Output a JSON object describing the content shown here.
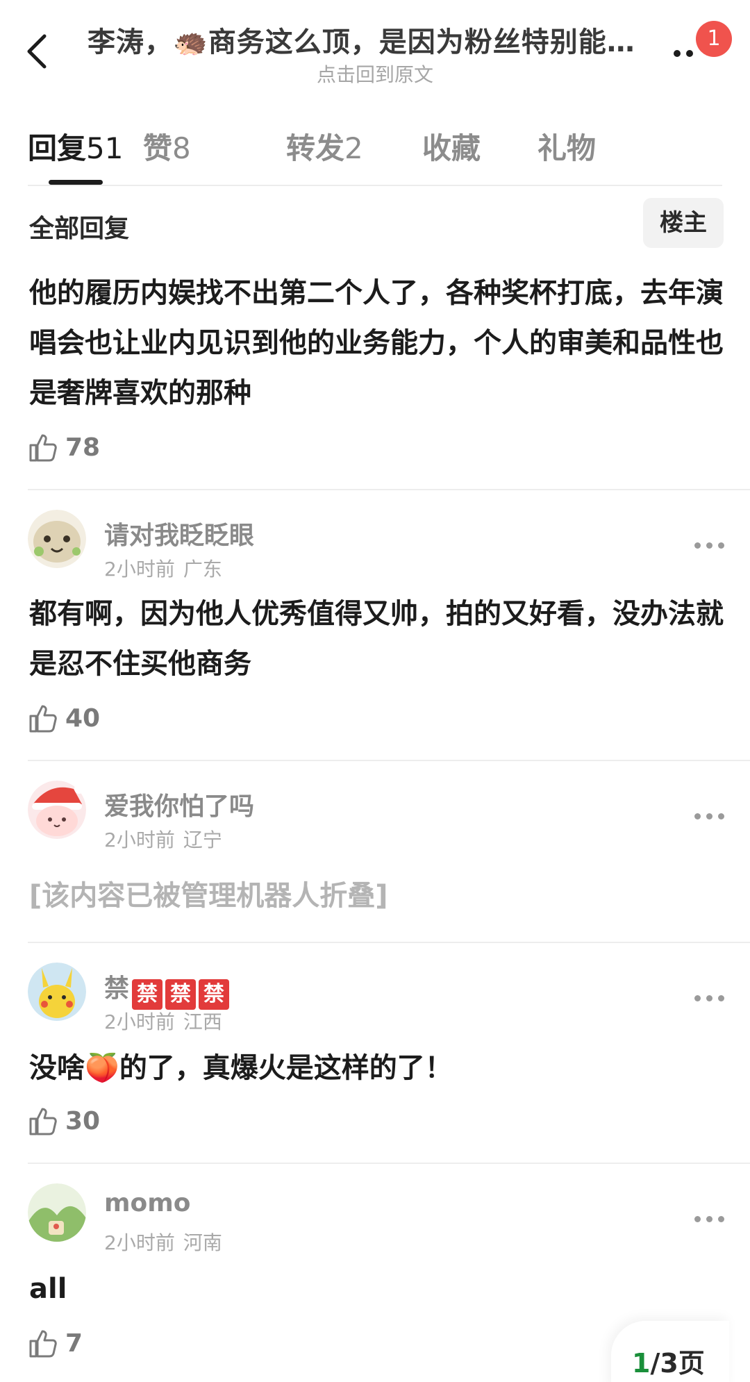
{
  "header": {
    "title_before": "李涛，",
    "title_emoji": "🦔",
    "title_after": "商务这么顶，是因为粉丝特别能…",
    "subtitle": "点击回到原文",
    "notification_count": "1"
  },
  "tabs": [
    {
      "label": "回复",
      "count": "51"
    },
    {
      "label": "赞",
      "count": "8"
    },
    {
      "label": "转发",
      "count": "2"
    },
    {
      "label": "收藏",
      "count": ""
    },
    {
      "label": "礼物",
      "count": ""
    }
  ],
  "section": {
    "title": "全部回复",
    "owner_button": "楼主"
  },
  "comments": [
    {
      "text": "他的履历内娱找不出第二个人了，各种奖杯打底，去年演唱会也让业内见识到他的业务能力，个人的审美和品性也是奢牌喜欢的那种",
      "likes": "78"
    },
    {
      "username": "请对我眨眨眼",
      "time": "2小时前",
      "location": "广东",
      "text": "都有啊，因为他人优秀值得又帅，拍的又好看，没办法就是忍不住买他商务",
      "likes": "40"
    },
    {
      "username": "爱我你怕了吗",
      "time": "2小时前",
      "location": "辽宁",
      "text": "[该内容已被管理机器人折叠]"
    },
    {
      "username": "禁",
      "username_badges": [
        "禁",
        "禁",
        "禁"
      ],
      "time": "2小时前",
      "location": "江西",
      "text_before": "没啥",
      "text_emoji": "🍑",
      "text_after": "的了，真爆火是这样的了！",
      "likes": "30"
    },
    {
      "username": "momo",
      "time": "2小时前",
      "location": "河南",
      "text": "all",
      "likes": "7"
    }
  ],
  "pager": {
    "current": "1",
    "rest": "/3页"
  },
  "colors": {
    "badge": "#f0534d",
    "pager_current": "#1a8f3a",
    "ban_badge": "#e23b3b"
  }
}
